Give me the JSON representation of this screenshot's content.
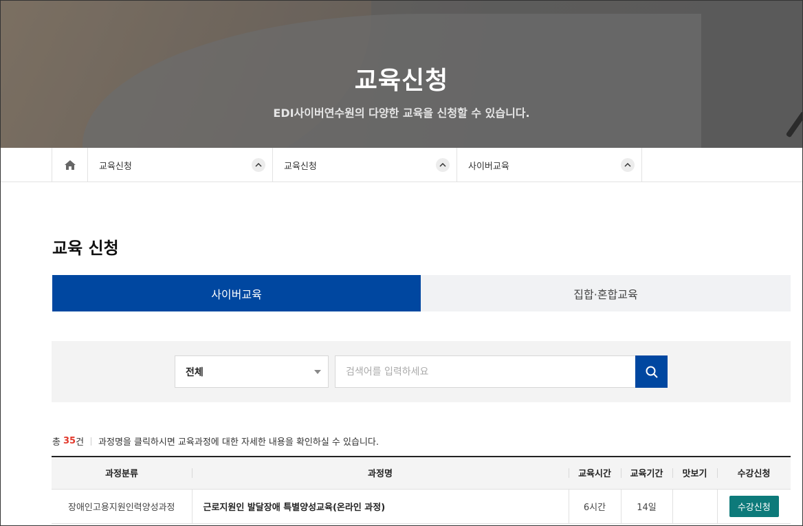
{
  "hero": {
    "title": "교육신청",
    "subtitle": "EDI사이버연수원의 다양한 교육을 신청할 수 있습니다."
  },
  "breadcrumb": {
    "home_icon": "home-icon",
    "items": [
      {
        "label": "교육신청"
      },
      {
        "label": "교육신청"
      },
      {
        "label": "사이버교육"
      }
    ]
  },
  "page": {
    "title": "교육 신청"
  },
  "tabs": [
    {
      "label": "사이버교육",
      "active": true
    },
    {
      "label": "집합·혼합교육",
      "active": false
    }
  ],
  "search": {
    "select_value": "전체",
    "placeholder": "검색어를 입력하세요",
    "value": ""
  },
  "summary": {
    "prefix": "총",
    "count": "35",
    "suffix": "건",
    "message": "과정명을 클릭하시면 교육과정에 대한 자세한 내용을 확인하실 수 있습니다."
  },
  "table": {
    "headers": [
      "과정분류",
      "과정명",
      "교육시간",
      "교육기간",
      "맛보기",
      "수강신청"
    ],
    "rows": [
      {
        "category": "장애인고용지원인력양성과정",
        "name": "근로지원인 발달장애 특별양성교육(온라인 과정)",
        "hours": "6시간",
        "period": "14일",
        "preview": "",
        "apply": "수강신청"
      }
    ]
  },
  "colors": {
    "primary": "#0047a0",
    "accent_count": "#e2382b",
    "apply_button": "#0d7a7a"
  }
}
